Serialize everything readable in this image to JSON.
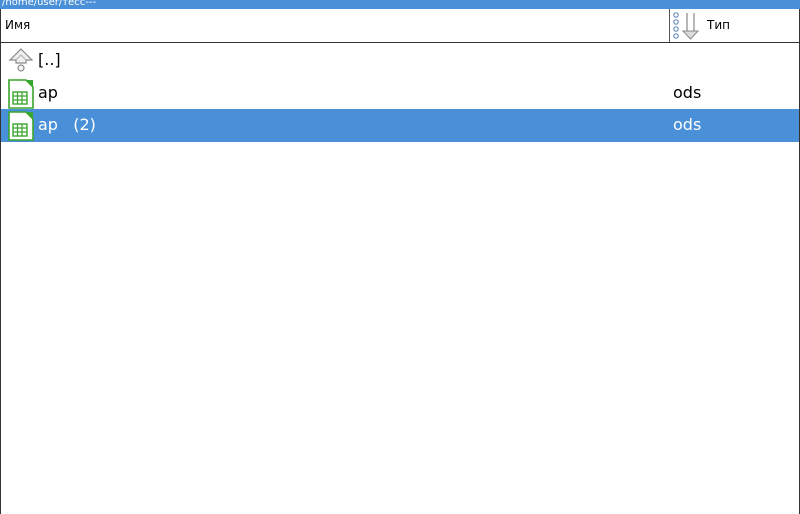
{
  "path": "/home/user/тесс---",
  "columns": {
    "name": "Имя",
    "type": "Тип"
  },
  "rows": [
    {
      "name": "[..]",
      "type": "",
      "icon": "parent-folder-icon",
      "selected": false
    },
    {
      "name": "ар",
      "type": "ods",
      "icon": "spreadsheet-file-icon",
      "selected": false
    },
    {
      "name": "ар   (2)",
      "type": "ods",
      "icon": "spreadsheet-file-icon",
      "selected": true
    }
  ],
  "colors": {
    "selection": "#4a90d9",
    "path_bar": "#4a90d9",
    "file_icon_green": "#3aa52c"
  }
}
